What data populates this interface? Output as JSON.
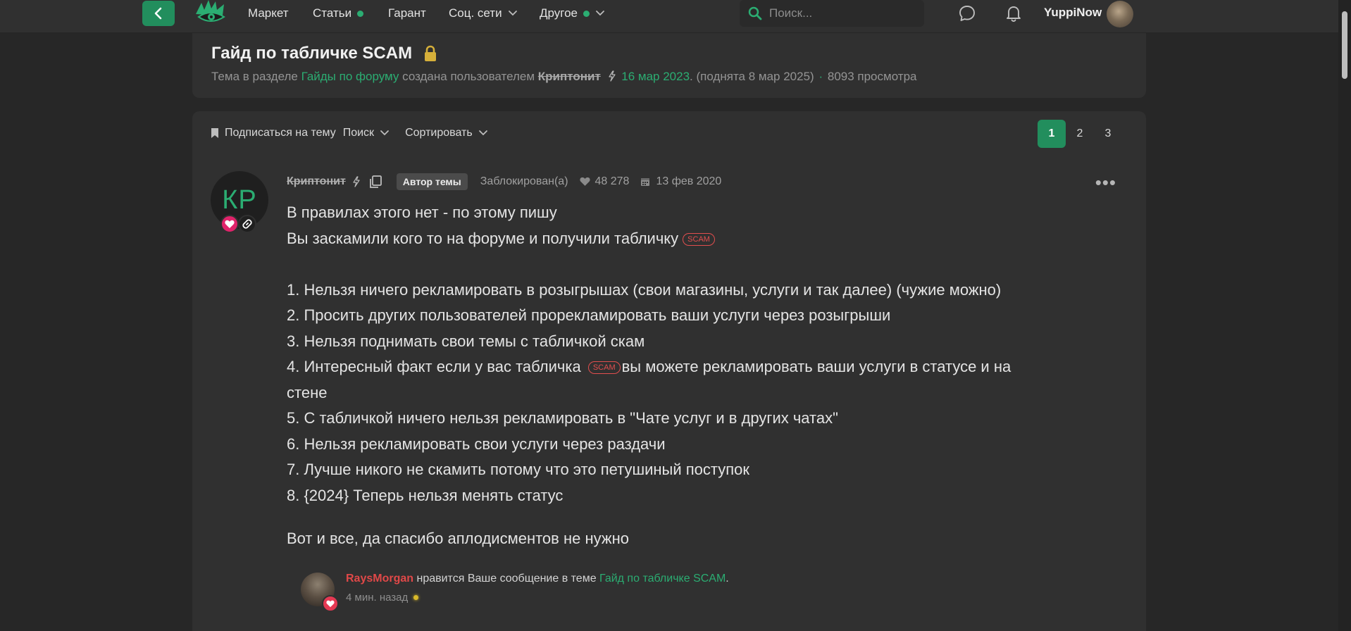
{
  "nav": {
    "items": [
      {
        "label": "Маркет"
      },
      {
        "label": "Статьи"
      },
      {
        "label": "Гарант"
      },
      {
        "label": "Соц. сети"
      },
      {
        "label": "Другое"
      }
    ],
    "search_placeholder": "Поиск...",
    "username": "YuppiNow"
  },
  "thread": {
    "title": "Гайд по табличке SCAM",
    "meta_prefix": "Тема в разделе",
    "section": "Гайды по форуму",
    "meta_created_by": "создана пользователем",
    "author": "Криптонит",
    "date": "16 мар 2023",
    "bumped": ". (поднята 8 мар 2025)",
    "views": "8093 просмотра"
  },
  "toolbar": {
    "subscribe": "Подписаться на тему",
    "search": "Поиск",
    "sort": "Сортировать"
  },
  "pagination": {
    "pages": [
      "1",
      "2",
      "3"
    ],
    "current": "1"
  },
  "post": {
    "avatar_initials": "КР",
    "author": "Криптонит",
    "author_tag": "Автор темы",
    "status": "Заблокирован(а)",
    "likes": "48 278",
    "reg_date": "13 фев 2020",
    "more": "•••",
    "scam_tag": "SCAM",
    "lines": {
      "l1": "В правилах этого нет - по этому пишу",
      "l2": "Вы заскамили кого то на форуме и получили табличку",
      "r1": "1. Нельзя ничего рекламировать в розыгрышах (свои магазины, услуги и так далее) (чужие можно)",
      "r2": "2. Просить других пользователей прорекламировать ваши услуги через розыгрыши",
      "r3": "3. Нельзя поднимать свои темы с табличкой скам",
      "r4a": "4. Интересный факт если у вас табличка",
      "r4b": "вы можете рекламировать ваши услуги в статусе и на",
      "r4c": "стене",
      "r5": "5. С табличкой ничего нельзя рекламировать в \"Чате услуг и в других чатах\"",
      "r6": "6. Нельзя рекламировать свои услуги через раздачи",
      "r7": "7. Лучше никого не скамить потому что это петушиный поступок",
      "r8": "8. {2024} Теперь нельзя менять статус",
      "closing": "Вот и все, да спасибо аплодисментов не нужно"
    }
  },
  "notification": {
    "user": "RaysMorgan",
    "text": "нравится Ваше сообщение в теме",
    "thread": "Гайд по табличке SCAM",
    "suffix": ".",
    "time": "4 мин. назад"
  },
  "colors": {
    "accent": "#228e5d",
    "link": "#2bad72",
    "scam": "#e24e4e",
    "heart": "#e53953",
    "background": "#272727",
    "card": "#303030"
  }
}
